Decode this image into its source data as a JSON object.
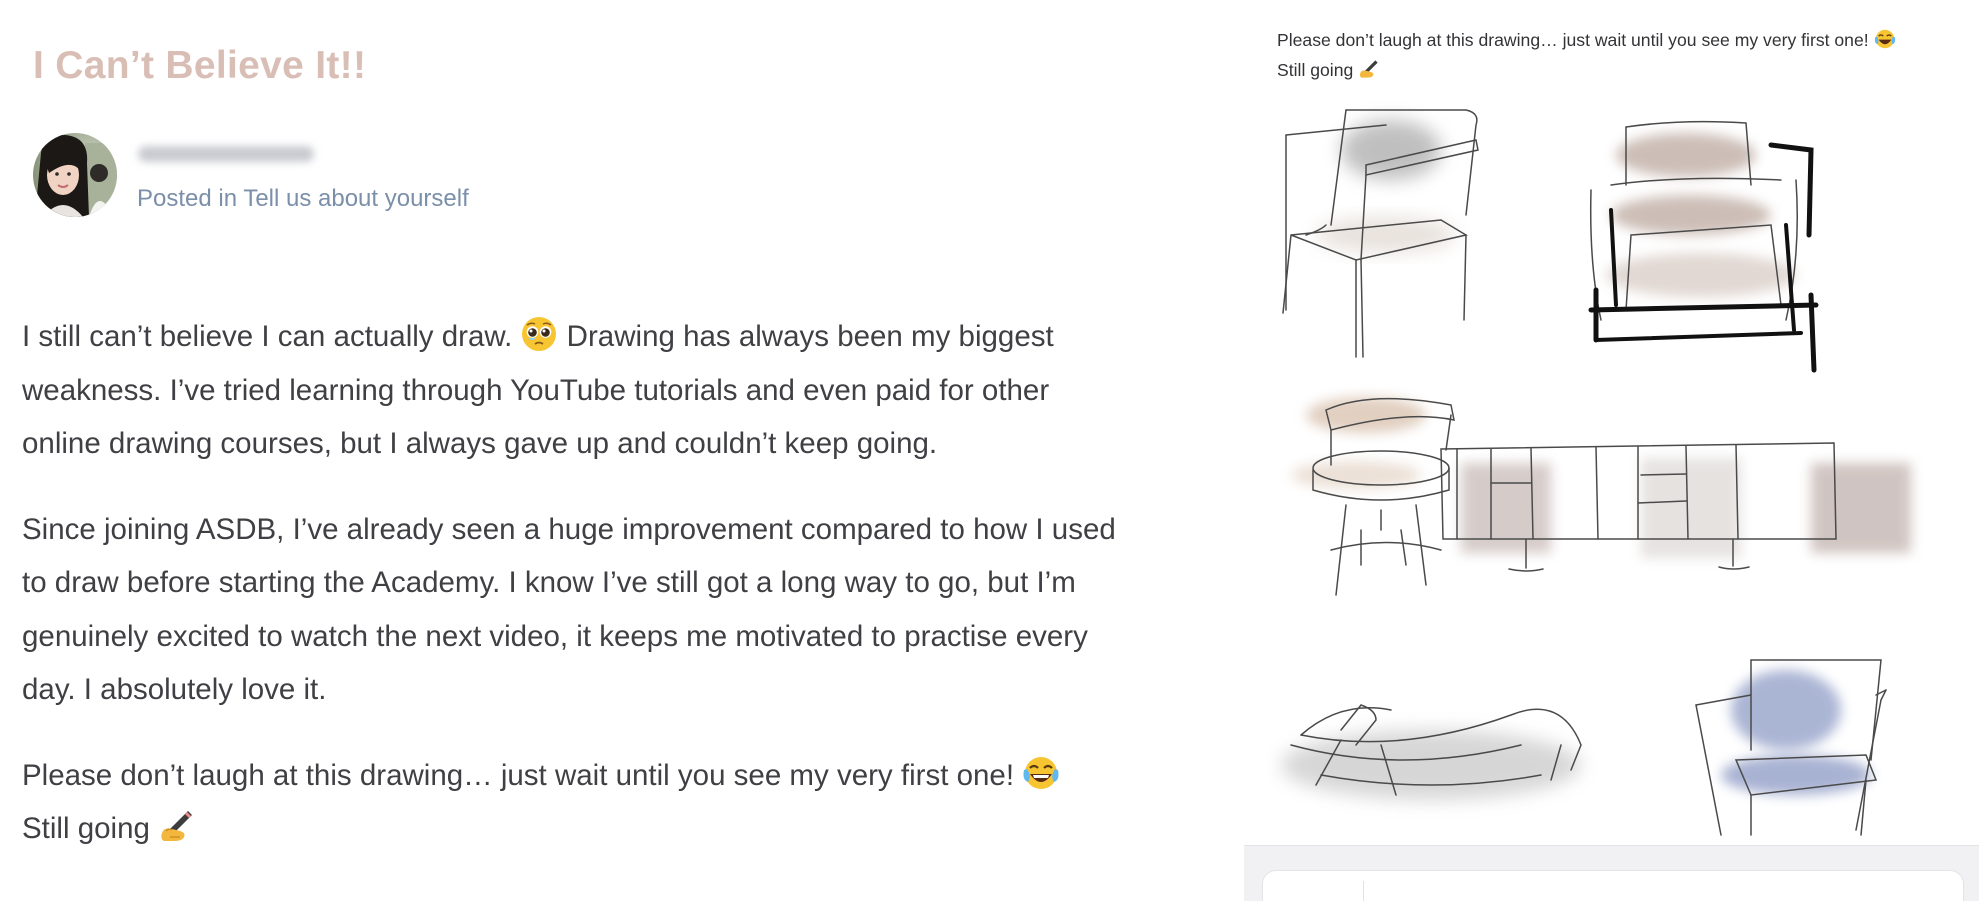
{
  "post": {
    "title": "I Can’t Believe It!!",
    "posted_in_prefix": "Posted in",
    "category": "Tell us about yourself",
    "paragraphs": [
      [
        "I still can’t believe I can actually draw. ",
        " Drawing has always been my biggest"
      ],
      [
        "weakness. I’ve tried learning through YouTube tutorials and even paid for other"
      ],
      [
        "online drawing courses, but I always gave up and couldn’t keep going."
      ]
    ],
    "p1": {
      "line1_a": "I still can’t believe I can actually draw.",
      "line1_b": "Drawing has always been my biggest",
      "line2": "weakness. I’ve tried learning through YouTube tutorials and even paid for other",
      "line3": "online drawing courses, but I always gave up and couldn’t keep going."
    },
    "p2": {
      "line1": "Since joining ASDB, I’ve already seen a huge improvement compared to how I used",
      "line2": "to draw before starting the Academy. I know I’ve still got a long way to go, but I’m",
      "line3": "genuinely excited to watch the next video, it keeps me motivated to practise every",
      "line4": "day. I absolutely love it."
    },
    "p3": {
      "line1": "Please don’t laugh at this drawing… just wait until you see my very first one!",
      "line2": "Still going"
    }
  },
  "panel": {
    "caption_line1": "Please don’t laugh at this drawing… just wait until you see my very first one!",
    "caption_line2": "Still going"
  },
  "icons": {
    "teary_face": "pleading-face-icon",
    "laughing_face": "tears-of-joy-icon",
    "writing_hand": "writing-hand-icon"
  },
  "colors": {
    "title": "#d9beb6",
    "meta_link": "#7b8fa9",
    "body_text": "#3f3f44"
  }
}
